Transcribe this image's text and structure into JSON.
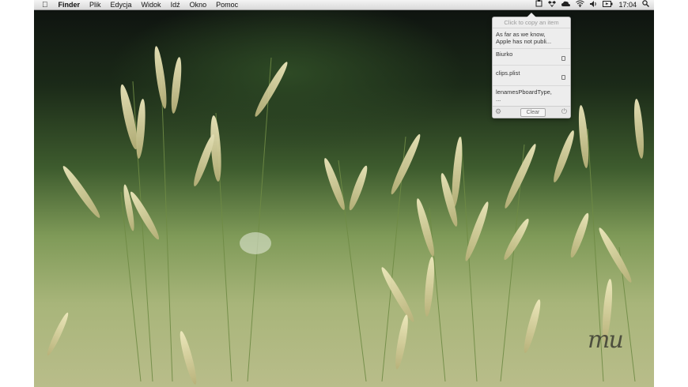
{
  "menubar": {
    "apple": "",
    "app_name": "Finder",
    "menus": [
      "Plik",
      "Edycja",
      "Widok",
      "Idź",
      "Okno",
      "Pomoc"
    ],
    "clock": "17:04"
  },
  "status_icons": [
    "clipboard-icon",
    "dropbox-icon",
    "cloud-icon",
    "wifi-icon",
    "volume-icon",
    "battery-icon",
    "spotlight-icon"
  ],
  "popup": {
    "header": "Click to copy an item",
    "items": [
      {
        "text1": "As far as we know,",
        "text2": "Apple has not publi..."
      },
      {
        "text1": "Biurko",
        "text2": ""
      },
      {
        "text1": "clips.plist",
        "text2": ""
      },
      {
        "text1": "lenamesPboardType,",
        "text2": "..."
      }
    ],
    "clear_label": "Clear"
  },
  "watermark": "mu"
}
